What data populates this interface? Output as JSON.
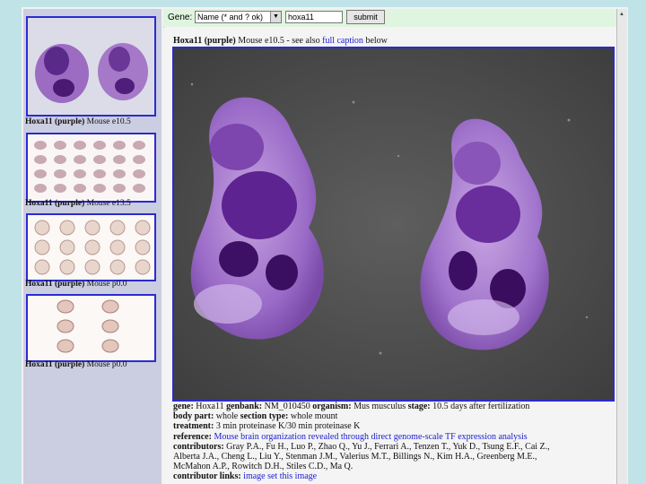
{
  "search": {
    "label": "Gene:",
    "select_value": "Name (* and ? ok)",
    "input_value": "hoxa11",
    "submit_label": "submit"
  },
  "thumbnails": [
    {
      "gene": "Hoxa11 (purple)",
      "desc": "Mouse e10.5"
    },
    {
      "gene": "Hoxa11 (purple)",
      "desc": "Mouse e13.5"
    },
    {
      "gene": "Hoxa11 (purple)",
      "desc": "Mouse p0.0"
    },
    {
      "gene": "Hoxa11 (purple)",
      "desc": "Mouse p0.0"
    }
  ],
  "main": {
    "caption_gene": "Hoxa11 (purple)",
    "caption_text": "Mouse e10.5 - see also",
    "caption_link": "full caption",
    "caption_tail": "below"
  },
  "meta": {
    "gene_label": "gene:",
    "gene": "Hoxa11",
    "genbank_label": "genbank:",
    "genbank": "NM_010450",
    "organism_label": "organism:",
    "organism": "Mus musculus",
    "stage_label": "stage:",
    "stage": "10.5 days after fertilization",
    "body_part_label": "body part:",
    "body_part": "whole",
    "section_type_label": "section type:",
    "section_type": "whole mount",
    "treatment_label": "treatment:",
    "treatment": "3 min proteinase K/30 min proteinase K",
    "reference_label": "reference:",
    "reference": "Mouse brain organization revealed through direct genome-scale TF expression analysis",
    "contributors_label": "contributors:",
    "contributors_1": "Gray P.A., Fu H., Luo P., Zhao Q., Yu J., Ferrari A., Tenzen T., Yuk D., Tsung E.F., Cai Z.,",
    "contributors_2": "Alberta J.A., Cheng L., Liu Y., Stenman J.M., Valerius M.T., Billings N., Kim H.A., Greenberg M.E.,",
    "contributors_3": "McMahon A.P., Rowitch D.H., Stiles C.D., Ma Q.",
    "links_label": "contributor links:",
    "links": "image set this image"
  }
}
